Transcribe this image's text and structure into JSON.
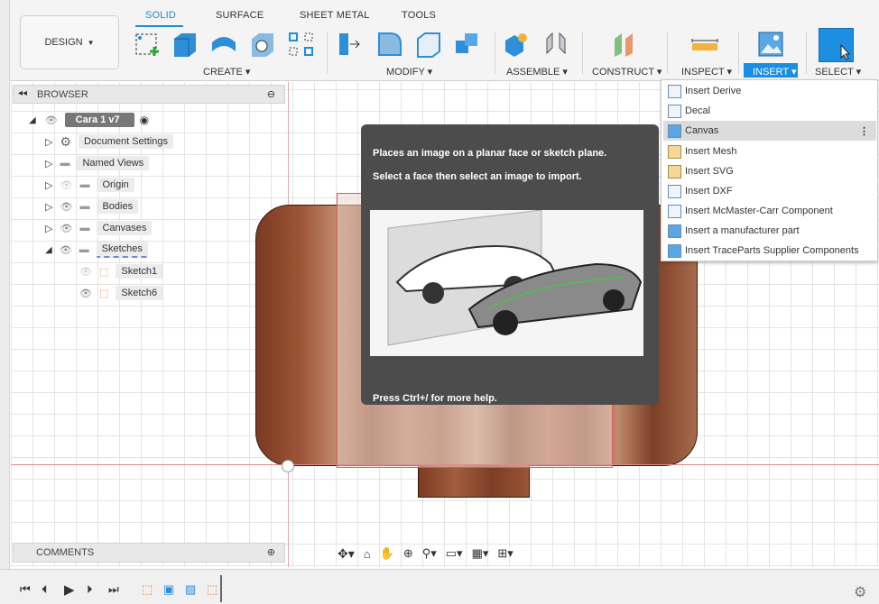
{
  "workspace": {
    "label": "DESIGN"
  },
  "tabs": [
    "SOLID",
    "SURFACE",
    "SHEET METAL",
    "TOOLS"
  ],
  "groups": {
    "create": "CREATE",
    "modify": "MODIFY",
    "assemble": "ASSEMBLE",
    "construct": "CONSTRUCT",
    "inspect": "INSPECT",
    "insert": "INSERT",
    "select": "SELECT"
  },
  "browser": {
    "title": "BROWSER",
    "root": "Cara 1 v7",
    "items": [
      "Document Settings",
      "Named Views",
      "Origin",
      "Bodies",
      "Canvases",
      "Sketches"
    ],
    "sketches": [
      "Sketch1",
      "Sketch6"
    ]
  },
  "comments": {
    "title": "COMMENTS"
  },
  "tooltip": {
    "line1": "Places an image on a planar face or sketch plane.",
    "line2": "Select a face then select an image to import.",
    "line3": "Press Ctrl+/ for more help."
  },
  "insert_menu": [
    "Insert Derive",
    "Decal",
    "Canvas",
    "Insert Mesh",
    "Insert SVG",
    "Insert DXF",
    "Insert McMaster-Carr Component",
    "Insert a manufacturer part",
    "Insert TraceParts Supplier Components"
  ],
  "icons": [
    "search-icon",
    "gear-icon",
    "eye-icon",
    "folder-icon",
    "play-icon"
  ],
  "colors": {
    "accent": "#1a8ee3",
    "tooltip_bg": "#4c4c4c",
    "sketch_line": "#e05c5c"
  }
}
